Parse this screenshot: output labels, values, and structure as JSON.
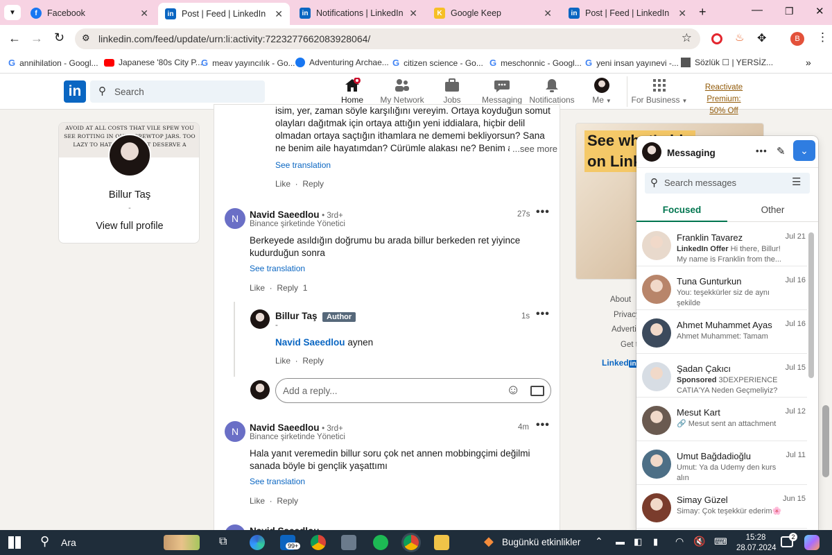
{
  "browser": {
    "tabs": [
      {
        "title": "Facebook",
        "color": "#1877f2",
        "glyph": "f"
      },
      {
        "title": "Post | Feed | LinkedIn",
        "color": "#0a66c2",
        "glyph": "in"
      },
      {
        "title": "Notifications | LinkedIn",
        "color": "#0a66c2",
        "glyph": "in"
      },
      {
        "title": "Google Keep",
        "color": "#f6bf26",
        "glyph": "K"
      },
      {
        "title": "Post | Feed | LinkedIn",
        "color": "#0a66c2",
        "glyph": "in"
      }
    ],
    "url": "linkedin.com/feed/update/urn:li:activity:7223277662083928064/",
    "profile_letter": "B",
    "bookmarks": [
      "annihilation - Googl...",
      "Japanese '80s City P...",
      "meav yayıncılık - Go...",
      "Adventuring Archae...",
      "citizen science - Go...",
      "meschonnic - Googl...",
      "yeni insan yayınevi -...",
      "Sözlük ☐ | YERSİZ..."
    ]
  },
  "linkedin": {
    "search_placeholder": "Search",
    "nav": {
      "home": "Home",
      "network": "My Network",
      "jobs": "Jobs",
      "messaging": "Messaging",
      "notifications": "Notifications",
      "me": "Me",
      "business": "For Business",
      "premium_line1": "Reactivate Premium:",
      "premium_line2": "50% Off"
    }
  },
  "profile_card": {
    "banner_text": "AVOID AT ALL COSTS THAT VILE SPEW YOU SEE ROTTING IN OUR SCREWTOP JARS. TOO LAZY TO HATE YOU DON'T DESERVE A PUBLIC.",
    "name": "Billur Taş",
    "dash": "-",
    "view_profile": "View full profile"
  },
  "feed": {
    "top_comment": {
      "text": "isim, yer, zaman söyle karşılığını vereyim. Ortaya koyduğun somut olayları dağıtmak için ortaya attığın yeni iddialara, hiçbir delil olmadan ortaya saçtığın ithamlara ne dememi bekliyorsun? Sana ne benim aile hayatımdan? Cürümle alakası ne? Benim annemin, babamın",
      "see_more": "...see more",
      "see_translation": "See translation",
      "like": "Like",
      "reply": "Reply"
    },
    "comment1": {
      "initial": "N",
      "name": "Navid Saeedlou",
      "degree": "• 3rd+",
      "headline": "Binance şirketinde Yönetici",
      "time": "27s",
      "text": "Berkeyede asıldığın doğrumu bu arada billur berkeden ret yiyince kudurduğun sonra",
      "see_translation": "See translation",
      "like": "Like",
      "reply": "Reply",
      "reply_count": "1"
    },
    "reply1": {
      "name": "Billur Taş",
      "badge": "Author",
      "headline": "-",
      "time": "1s",
      "mention": "Navid Saeedlou",
      "text": "aynen",
      "like": "Like",
      "reply": "Reply"
    },
    "reply_box": {
      "placeholder": "Add a reply..."
    },
    "comment2": {
      "initial": "N",
      "name": "Navid Saeedlou",
      "degree": "• 3rd+",
      "headline": "Binance şirketinde Yönetici",
      "time": "4m",
      "text": "Hala yanıt veremedin billur soru çok net annen mobbingçimi değilmi sanada böyle bi gençlik yaşattımı",
      "see_translation": "See translation",
      "like": "Like",
      "reply": "Reply"
    },
    "comment3_name": "Navid Saeedlou"
  },
  "right_rail": {
    "ad_text": "See what's hi on Linke",
    "footer": [
      "About",
      "Privacy",
      "Advertis",
      "Get t"
    ],
    "brand": "Linked"
  },
  "messaging": {
    "title": "Messaging",
    "search_placeholder": "Search messages",
    "tab_focused": "Focused",
    "tab_other": "Other",
    "conversations": [
      {
        "name": "Franklin Tavarez",
        "date": "Jul 21",
        "preview_bold": "LinkedIn Offer",
        "preview": "Hi there, Billur! My name is Franklin from the...",
        "color": "#e8d9cc"
      },
      {
        "name": "Tuna Gunturkun",
        "date": "Jul 16",
        "preview_bold": "",
        "preview": "You: teşekkürler siz de aynı şekilde",
        "color": "#b8856a"
      },
      {
        "name": "Ahmet Muhammet Ayas",
        "date": "Jul 16",
        "preview_bold": "",
        "preview": "Ahmet Muhammet: Tamam",
        "color": "#3c4a5c"
      },
      {
        "name": "Şadan Çakıcı",
        "date": "Jul 15",
        "preview_bold": "Sponsored",
        "preview": "3DEXPERIENCE CATIA'YA Neden Geçmeliyiz?",
        "color": "#d7dde4"
      },
      {
        "name": "Mesut Kart",
        "date": "Jul 12",
        "preview_bold": "",
        "preview": "🔗 Mesut sent an attachment",
        "color": "#6a5a50"
      },
      {
        "name": "Umut Bağdadioğlu",
        "date": "Jul 11",
        "preview_bold": "",
        "preview": "Umut: Ya da Udemy den kurs alın",
        "color": "#4d6f86"
      },
      {
        "name": "Simay Güzel",
        "date": "Jun 15",
        "preview_bold": "",
        "preview": "Simay: Çok teşekkür ederim🌸",
        "color": "#7a3c2c"
      }
    ]
  },
  "taskbar": {
    "search": "Ara",
    "mail_badge": "99+",
    "weather": "Bugünkü etkinlikler",
    "time": "15:28",
    "date": "28.07.2024",
    "notif_count": "2"
  }
}
